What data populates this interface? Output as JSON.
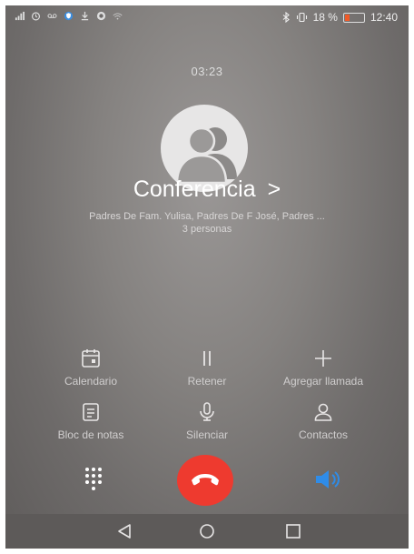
{
  "status_bar": {
    "battery": "18 %",
    "time": "12:40",
    "icons": [
      "signal-icon",
      "alarm-icon",
      "voicemail-icon",
      "shield-app-icon",
      "download-icon",
      "chat-app-icon",
      "wifi-call-icon",
      "bluetooth-icon",
      "vibrate-icon",
      "battery-icon"
    ]
  },
  "call": {
    "duration": "03:23",
    "title": "Conferencia",
    "participants": "Padres De Fam. Yulisa, Padres De F José, Padres ...",
    "count": "3 personas"
  },
  "controls": [
    {
      "label": "Calendario",
      "icon": "calendar-icon"
    },
    {
      "label": "Retener",
      "icon": "pause-icon"
    },
    {
      "label": "Agregar llamada",
      "icon": "add-icon"
    },
    {
      "label": "Bloc de notas",
      "icon": "notes-icon"
    },
    {
      "label": "Silenciar",
      "icon": "microphone-icon"
    },
    {
      "label": "Contactos",
      "icon": "contacts-icon"
    }
  ],
  "colors": {
    "end_call": "#ee3a2f",
    "speaker_active": "#2f8ce8",
    "background": "#858280"
  }
}
